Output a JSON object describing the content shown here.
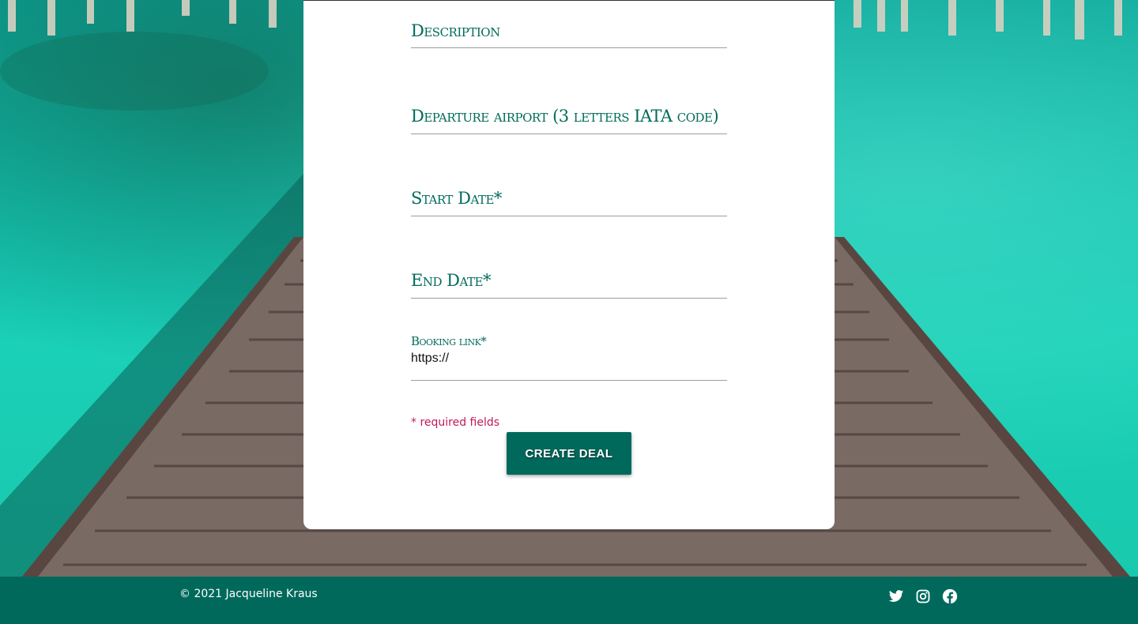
{
  "form": {
    "description_label": "Description",
    "departure_label": "Departure airport (3 letters IATA code)",
    "start_date_label": "Start Date*",
    "end_date_label": "End Date*",
    "booking_link_label": "Booking link*",
    "booking_link_value": "https://",
    "required_note": "* required fields",
    "submit_label": "CREATE DEAL"
  },
  "footer": {
    "copyright": "© 2021 Jacqueline Kraus",
    "social_icons": [
      "twitter-icon",
      "instagram-icon",
      "facebook-icon"
    ]
  },
  "colors": {
    "accent": "#00695c",
    "label": "#006b5b",
    "required": "#c2185b"
  }
}
